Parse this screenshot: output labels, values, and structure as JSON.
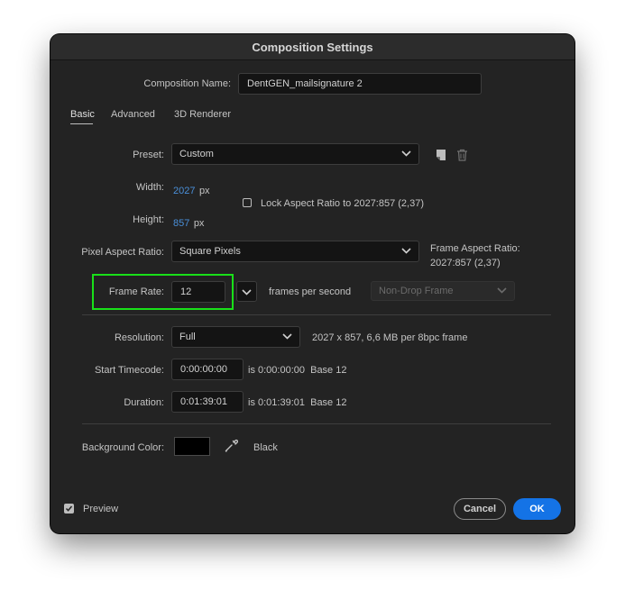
{
  "dialog": {
    "title": "Composition Settings"
  },
  "composition_name": {
    "label": "Composition Name:",
    "value": "DentGEN_mailsignature 2"
  },
  "tabs": [
    {
      "label": "Basic",
      "active": true
    },
    {
      "label": "Advanced",
      "active": false
    },
    {
      "label": "3D Renderer",
      "active": false
    }
  ],
  "preset": {
    "label": "Preset:",
    "value": "Custom"
  },
  "width": {
    "label": "Width:",
    "value": "2027",
    "unit": "px"
  },
  "height": {
    "label": "Height:",
    "value": "857",
    "unit": "px"
  },
  "lock_aspect": {
    "label": "Lock Aspect Ratio to 2027:857 (2,37)",
    "checked": false
  },
  "pixel_aspect": {
    "label": "Pixel Aspect Ratio:",
    "value": "Square Pixels"
  },
  "frame_aspect": {
    "label": "Frame Aspect Ratio:",
    "value": "2027:857 (2,37)"
  },
  "frame_rate": {
    "label": "Frame Rate:",
    "value": "12",
    "unit": "frames per second",
    "drop_frame": "Non-Drop Frame"
  },
  "resolution": {
    "label": "Resolution:",
    "value": "Full",
    "info": "2027 x 857, 6,6 MB per 8bpc frame"
  },
  "start_timecode": {
    "label": "Start Timecode:",
    "value": "0:00:00:00",
    "info": "is 0:00:00:00  Base 12"
  },
  "duration": {
    "label": "Duration:",
    "value": "0:01:39:01",
    "info": "is 0:01:39:01  Base 12"
  },
  "background": {
    "label": "Background Color:",
    "color": "#000000",
    "name": "Black"
  },
  "preview": {
    "label": "Preview",
    "checked": true
  },
  "buttons": {
    "cancel": "Cancel",
    "ok": "OK"
  },
  "colors": {
    "accent": "#1473e6",
    "highlight": "#19e019",
    "link_blue": "#4a8fd8"
  }
}
